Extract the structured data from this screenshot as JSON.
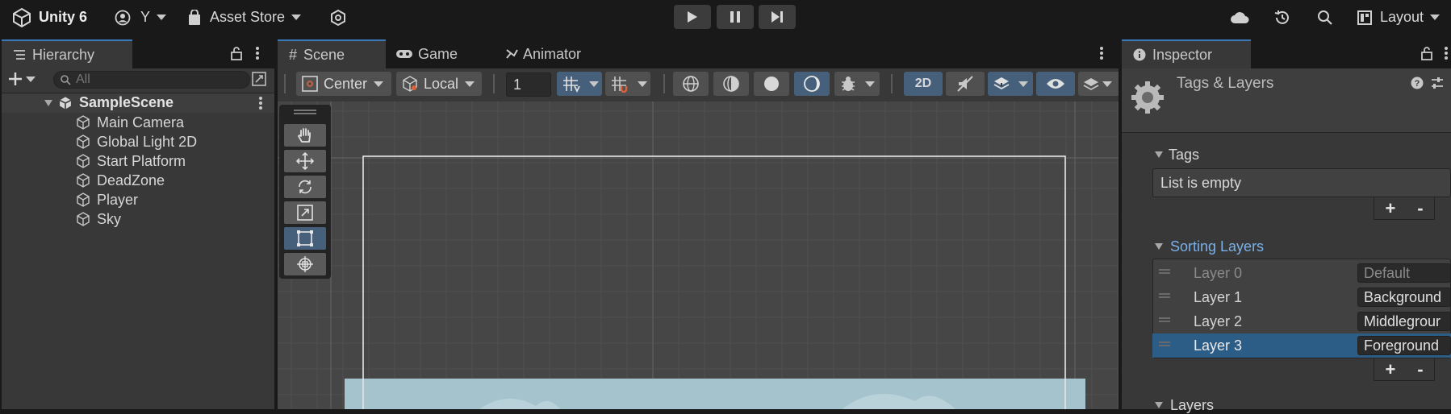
{
  "topbar": {
    "app_name": "Unity 6",
    "account": "Y",
    "asset_store": "Asset Store",
    "layout": "Layout"
  },
  "hierarchy": {
    "tab": "Hierarchy",
    "search_placeholder": "All",
    "scene": "SampleScene",
    "items": [
      "Main Camera",
      "Global Light 2D",
      "Start Platform",
      "DeadZone",
      "Player",
      "Sky"
    ]
  },
  "scene_view": {
    "tabs": [
      "Scene",
      "Game",
      "Animator"
    ],
    "pivot": "Center",
    "space": "Local",
    "grid_size": "1",
    "mode_2d": "2D"
  },
  "inspector": {
    "tab": "Inspector",
    "title": "Tags & Layers",
    "tags_header": "Tags",
    "tags_empty": "List is empty",
    "sorting_header": "Sorting Layers",
    "sorting_layers": [
      {
        "name": "Layer 0",
        "value": "Default"
      },
      {
        "name": "Layer 1",
        "value": "Background"
      },
      {
        "name": "Layer 2",
        "value": "Middlegrour"
      },
      {
        "name": "Layer 3",
        "value": "Foreground"
      }
    ],
    "layers_header": "Layers",
    "plus": "+",
    "minus": "-"
  },
  "colors": {
    "accent": "#3a79bb",
    "selected_row": "#2c5d87",
    "sky": "#a5c3cd",
    "scene_bg": "#464646"
  }
}
